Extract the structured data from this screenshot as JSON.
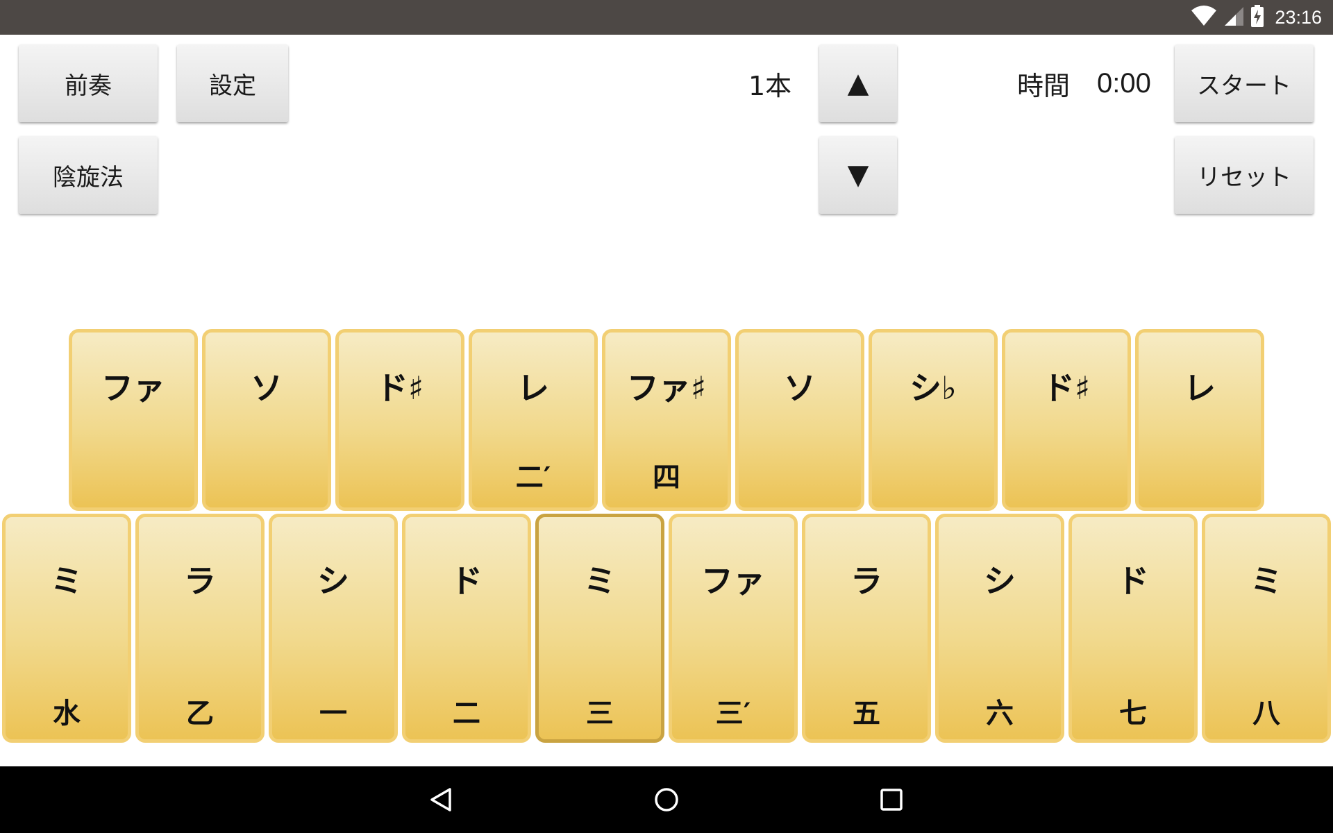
{
  "status_bar": {
    "time": "23:16"
  },
  "controls": {
    "prelude_label": "前奏",
    "settings_label": "設定",
    "in_scale_label": "陰旋法",
    "pitch_value": "1本",
    "up_label": "▲",
    "down_label": "▼",
    "time_label": "時間",
    "time_value": "0:00",
    "start_label": "スタート",
    "reset_label": "リセット"
  },
  "keys": {
    "top": [
      {
        "note": "ファ",
        "num": ""
      },
      {
        "note": "ソ",
        "num": ""
      },
      {
        "note": "ド♯",
        "num": ""
      },
      {
        "note": "レ",
        "num": "二′"
      },
      {
        "note": "ファ♯",
        "num": "四"
      },
      {
        "note": "ソ",
        "num": ""
      },
      {
        "note": "シ♭",
        "num": ""
      },
      {
        "note": "ド♯",
        "num": ""
      },
      {
        "note": "レ",
        "num": ""
      }
    ],
    "bottom": [
      {
        "note": "ミ",
        "num": "水"
      },
      {
        "note": "ラ",
        "num": "乙"
      },
      {
        "note": "シ",
        "num": "一"
      },
      {
        "note": "ド",
        "num": "二"
      },
      {
        "note": "ミ",
        "num": "三"
      },
      {
        "note": "ファ",
        "num": "三′"
      },
      {
        "note": "ラ",
        "num": "五"
      },
      {
        "note": "シ",
        "num": "六"
      },
      {
        "note": "ド",
        "num": "七"
      },
      {
        "note": "ミ",
        "num": "八"
      }
    ],
    "selected_bottom_index": 4
  },
  "icons": {
    "wifi": "wifi-icon",
    "signal": "signal-icon",
    "battery": "battery-charging-icon",
    "back": "back-icon",
    "home": "home-icon",
    "recents": "recents-icon"
  },
  "colors": {
    "key_border": "#f2cf73",
    "key_border_selected": "#c9a341",
    "status_bar": "#4d4845"
  }
}
